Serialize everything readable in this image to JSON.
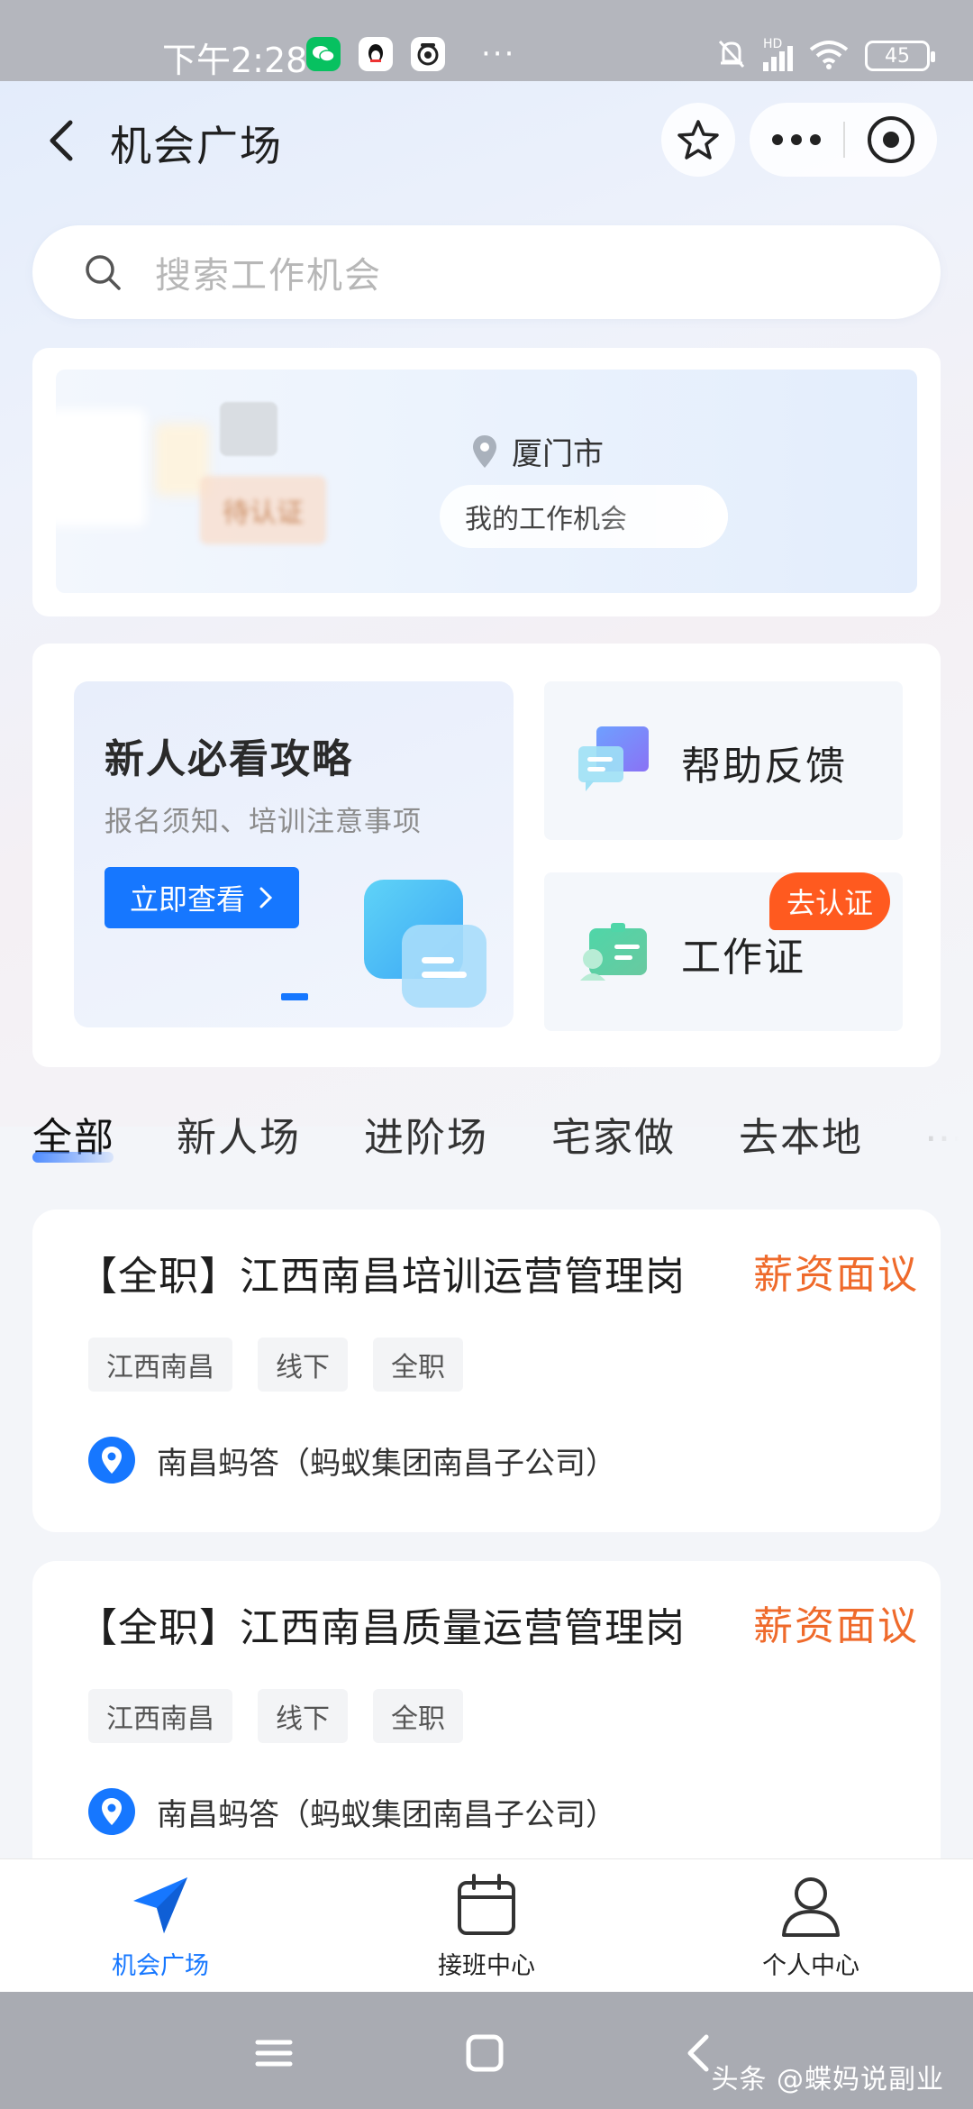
{
  "status_bar": {
    "time": "下午2:28",
    "battery": "45",
    "network": "HD",
    "dots": "···"
  },
  "nav": {
    "title": "机会广场"
  },
  "search": {
    "placeholder": "搜索工作机会"
  },
  "profile": {
    "city": "厦门市",
    "cert_status": "待认证",
    "work_pill": "我的工作机会"
  },
  "entries": {
    "guide_title": "新人必看攻略",
    "guide_subtitle": "报名须知、培训注意事项",
    "guide_button": "立即查看",
    "help_label": "帮助反馈",
    "cert_label": "工作证",
    "cert_tag": "去认证"
  },
  "tabs": [
    "全部",
    "新人场",
    "进阶场",
    "宅家做",
    "去本地"
  ],
  "jobs": [
    {
      "title": "【全职】江西南昌培训运营管理岗",
      "salary": "薪资面议",
      "tags": [
        "江西南昌",
        "线下",
        "全职"
      ],
      "company": "南昌蚂答（蚂蚁集团南昌子公司）"
    },
    {
      "title": "【全职】江西南昌质量运营管理岗",
      "salary": "薪资面议",
      "tags": [
        "江西南昌",
        "线下",
        "全职"
      ],
      "company": "南昌蚂答（蚂蚁集团南昌子公司）"
    }
  ],
  "tabbar": [
    {
      "label": "机会广场",
      "icon": "paper-plane-icon",
      "active": true
    },
    {
      "label": "接班中心",
      "icon": "calendar-icon",
      "active": false
    },
    {
      "label": "个人中心",
      "icon": "person-icon",
      "active": false
    }
  ],
  "watermark": "头条 @蝶妈说副业",
  "colors": {
    "primary": "#1677ff",
    "salary": "#ef6a2b",
    "cert_tag": "#ff5a1f"
  }
}
